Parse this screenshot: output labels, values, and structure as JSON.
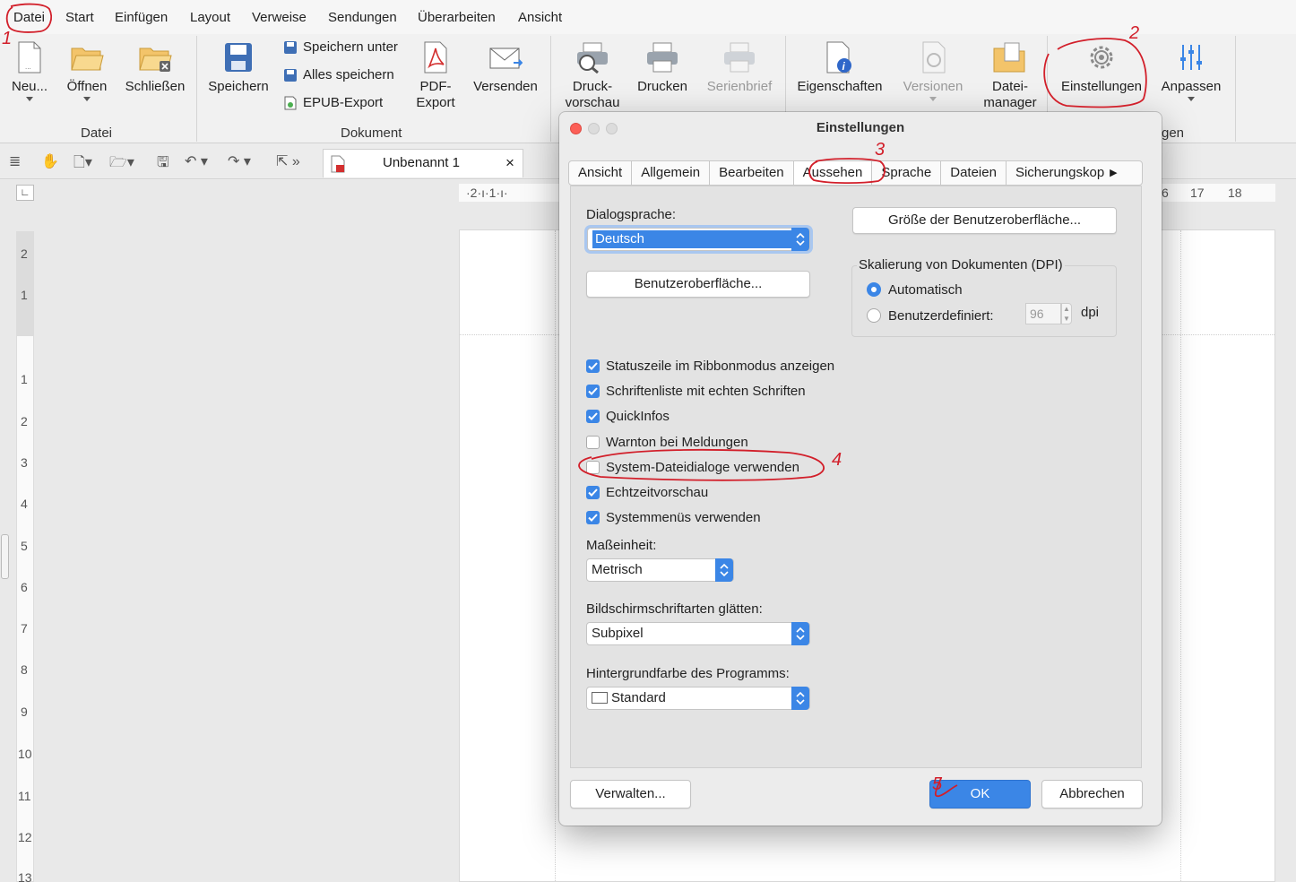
{
  "menubar": {
    "items": [
      "Datei",
      "Start",
      "Einfügen",
      "Layout",
      "Verweise",
      "Sendungen",
      "Überarbeiten",
      "Ansicht"
    ]
  },
  "ribbon": {
    "new_label": "Neu...",
    "open_label": "Öffnen",
    "close_label": "Schließen",
    "group_datei": "Datei",
    "save_label": "Speichern",
    "save_as_label": "Speichern unter",
    "save_all_label": "Alles speichern",
    "epub_label": "EPUB-Export",
    "pdf_label_1": "PDF-",
    "pdf_label_2": "Export",
    "send_label": "Versenden",
    "group_dokument": "Dokument",
    "print_preview_1": "Druck-",
    "print_preview_2": "vorschau",
    "print_label": "Drucken",
    "mailmerge_label": "Serienbrief",
    "properties_label": "Eigenschaften",
    "versions_label": "Versionen",
    "filemanager_1": "Datei-",
    "filemanager_2": "manager",
    "settings_label": "Einstellungen",
    "customize_label": "Anpassen",
    "group_partial": "gen"
  },
  "toolbar": {
    "doc_tab_title": "Unbenannt 1",
    "doc_tab_close": "×"
  },
  "ruler": {
    "h_left": "·2·ı·1·ı·",
    "h_right_1": "6",
    "h_right_2": "17",
    "h_right_3": "18",
    "v_numbers": [
      "2",
      "1",
      "1",
      "2",
      "3",
      "4",
      "5",
      "6",
      "7",
      "8",
      "9",
      "10",
      "11",
      "12",
      "13"
    ]
  },
  "dialog": {
    "title": "Einstellungen",
    "tabs": [
      "Ansicht",
      "Allgemein",
      "Bearbeiten",
      "Aussehen",
      "Sprache",
      "Dateien",
      "Sicherungskop"
    ],
    "active_tab": "Aussehen",
    "dialog_language_label": "Dialogsprache:",
    "dialog_language_value": "Deutsch",
    "ui_button": "Benutzeroberfläche...",
    "ui_size_button": "Größe der Benutzeroberfläche...",
    "scaling_group_label": "Skalierung von Dokumenten (DPI)",
    "scaling_auto": "Automatisch",
    "scaling_custom": "Benutzerdefiniert:",
    "dpi_value": "96",
    "dpi_unit": "dpi",
    "checkboxes": [
      {
        "label": "Statuszeile im Ribbonmodus anzeigen",
        "checked": true
      },
      {
        "label": "Schriftenliste mit echten Schriften",
        "checked": true
      },
      {
        "label": "QuickInfos",
        "checked": true
      },
      {
        "label": "Warnton bei Meldungen",
        "checked": false
      },
      {
        "label": "System-Dateidialoge verwenden",
        "checked": false
      },
      {
        "label": "Echtzeitvorschau",
        "checked": true
      },
      {
        "label": "Systemmenüs verwenden",
        "checked": true
      }
    ],
    "unit_label": "Maßeinheit:",
    "unit_value": "Metrisch",
    "smoothing_label": "Bildschirmschriftarten glätten:",
    "smoothing_value": "Subpixel",
    "bgcolor_label": "Hintergrundfarbe des Programms:",
    "bgcolor_value": "Standard",
    "manage_button": "Verwalten...",
    "ok_button": "OK",
    "cancel_button": "Abbrechen"
  },
  "annotations": {
    "step1": "1",
    "step2": "2",
    "step3": "3",
    "step4": "4",
    "step5": "5"
  },
  "colors": {
    "accent_blue": "#3b86e6",
    "annotation_red": "#d21f2a"
  }
}
